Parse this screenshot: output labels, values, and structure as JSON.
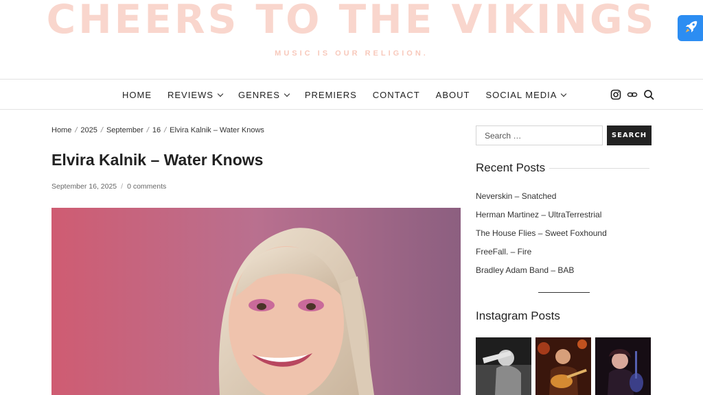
{
  "site": {
    "title": "CHEERS TO THE VIKINGS",
    "tagline": "MUSIC IS OUR RELIGION."
  },
  "colors": {
    "title_pink": "#f9d6cd",
    "rocket_blue": "#2c8df2",
    "button_dark": "#222222"
  },
  "nav": {
    "items": [
      {
        "label": "HOME",
        "has_dropdown": false
      },
      {
        "label": "REVIEWS",
        "has_dropdown": true
      },
      {
        "label": "GENRES",
        "has_dropdown": true
      },
      {
        "label": "PREMIERS",
        "has_dropdown": false
      },
      {
        "label": "CONTACT",
        "has_dropdown": false
      },
      {
        "label": "ABOUT",
        "has_dropdown": false
      },
      {
        "label": "SOCIAL MEDIA",
        "has_dropdown": true
      }
    ],
    "icons": [
      "instagram-icon",
      "link-icon",
      "search-icon"
    ]
  },
  "breadcrumb": [
    "Home",
    "2025",
    "September",
    "16",
    "Elvira Kalnik – Water Knows"
  ],
  "post": {
    "title": "Elvira Kalnik – Water Knows",
    "date": "September 16, 2025",
    "comments": "0 comments"
  },
  "sidebar": {
    "search": {
      "placeholder": "Search …",
      "button": "SEARCH"
    },
    "recent_title": "Recent Posts",
    "recent_posts": [
      "Neverskin – Snatched",
      "Herman Martinez – UltraTerrestrial",
      "The House Flies – Sweet Foxhound",
      "FreeFall. – Fire",
      "Bradley Adam Band – BAB"
    ],
    "instagram_title": "Instagram Posts"
  }
}
